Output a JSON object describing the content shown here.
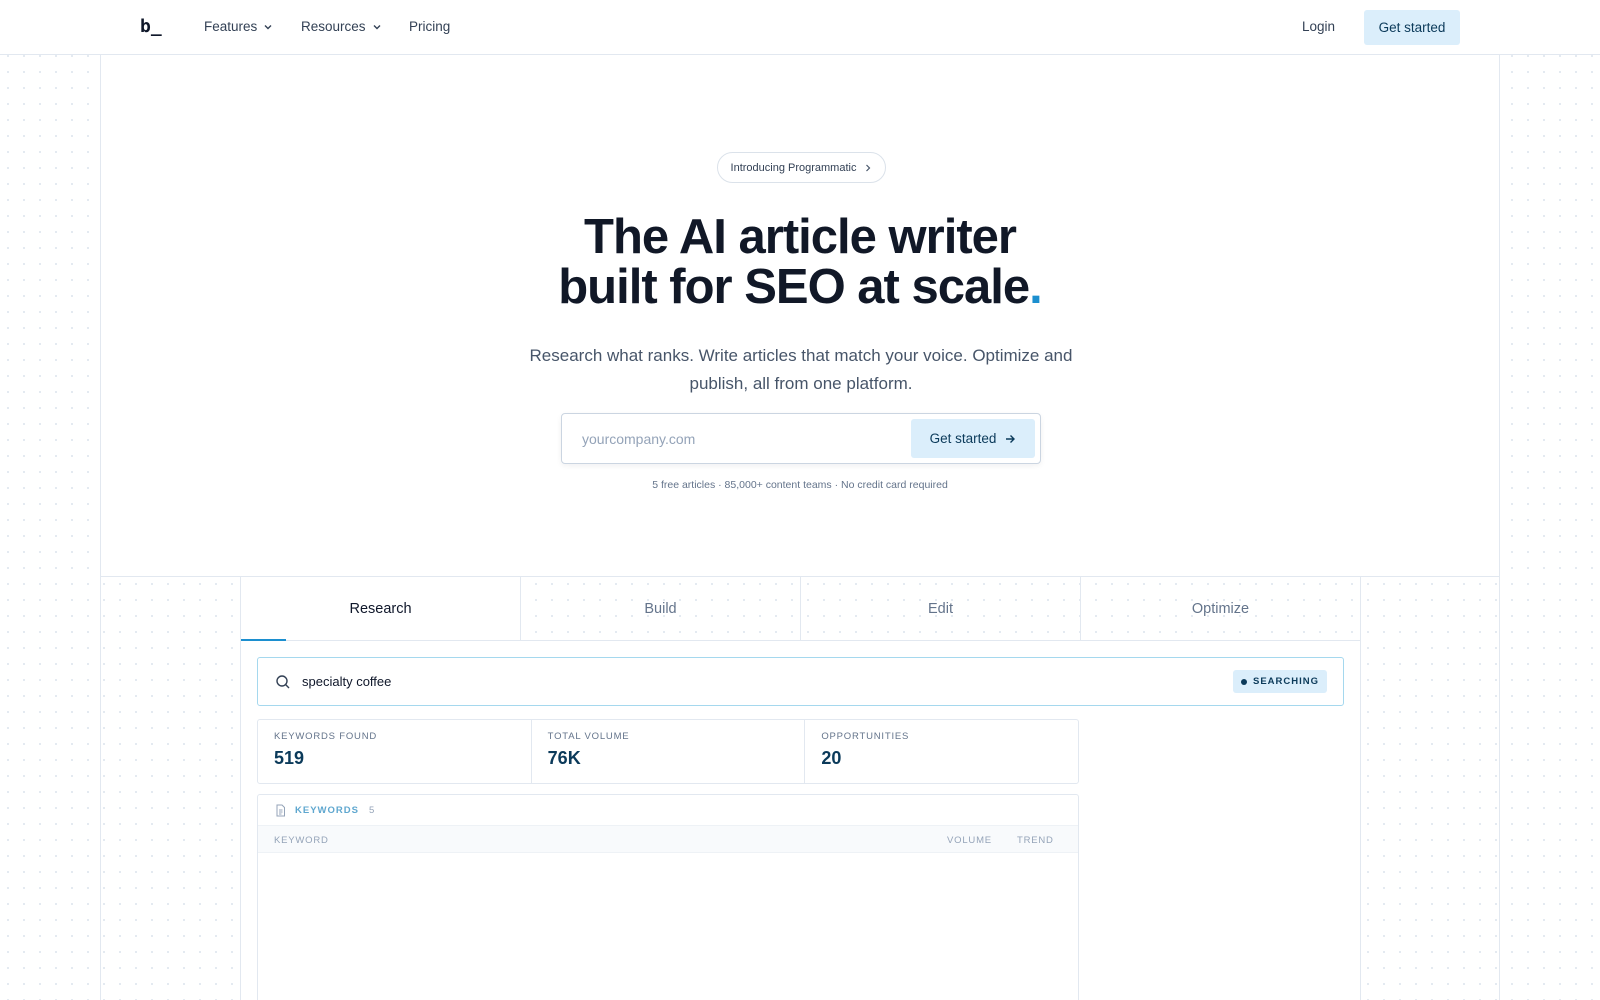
{
  "nav": {
    "logo": "b_",
    "items": [
      {
        "label": "Features",
        "has_dropdown": true
      },
      {
        "label": "Resources",
        "has_dropdown": true
      },
      {
        "label": "Pricing",
        "has_dropdown": false
      }
    ],
    "login_label": "Login",
    "cta_label": "Get started"
  },
  "hero": {
    "announcement": "Introducing Programmatic",
    "headline_line1": "The AI article writer",
    "headline_line2": "built for SEO at scale",
    "headline_dot": ".",
    "subheadline": "Research what ranks. Write articles that match your voice. Optimize and publish, all from one platform.",
    "input_placeholder": "yourcompany.com",
    "cta_label": "Get started",
    "fine_print": "5 free articles · 85,000+ content teams · No credit card required"
  },
  "demo": {
    "tabs": [
      {
        "label": "Research",
        "active": true
      },
      {
        "label": "Build",
        "active": false
      },
      {
        "label": "Edit",
        "active": false
      },
      {
        "label": "Optimize",
        "active": false
      }
    ],
    "search_query": "specialty coffee",
    "status_badge": "SEARCHING",
    "stats": [
      {
        "label": "KEYWORDS FOUND",
        "value": "519"
      },
      {
        "label": "TOTAL VOLUME",
        "value": "76K"
      },
      {
        "label": "OPPORTUNITIES",
        "value": "20"
      }
    ],
    "keywords": {
      "title": "KEYWORDS",
      "count": "5",
      "col_keyword": "KEYWORD",
      "col_volume": "VOLUME",
      "col_trend": "TREND"
    }
  },
  "colors": {
    "accent": "#1c8fcf",
    "button_bg": "#dbeefb",
    "button_text": "#0b3a5a"
  },
  "icons": [
    "chevron-down-icon",
    "chevron-right-icon",
    "arrow-right-icon",
    "search-icon",
    "document-icon"
  ]
}
